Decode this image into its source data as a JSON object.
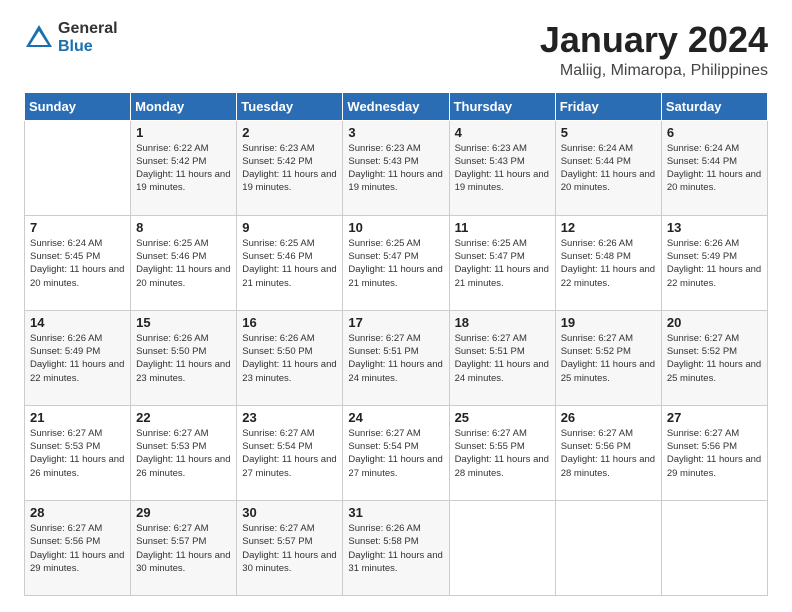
{
  "logo": {
    "general": "General",
    "blue": "Blue"
  },
  "header": {
    "title": "January 2024",
    "subtitle": "Maliig, Mimaropa, Philippines"
  },
  "weekdays": [
    "Sunday",
    "Monday",
    "Tuesday",
    "Wednesday",
    "Thursday",
    "Friday",
    "Saturday"
  ],
  "weeks": [
    [
      {
        "day": "",
        "sunrise": "",
        "sunset": "",
        "daylight": ""
      },
      {
        "day": "1",
        "sunrise": "Sunrise: 6:22 AM",
        "sunset": "Sunset: 5:42 PM",
        "daylight": "Daylight: 11 hours and 19 minutes."
      },
      {
        "day": "2",
        "sunrise": "Sunrise: 6:23 AM",
        "sunset": "Sunset: 5:42 PM",
        "daylight": "Daylight: 11 hours and 19 minutes."
      },
      {
        "day": "3",
        "sunrise": "Sunrise: 6:23 AM",
        "sunset": "Sunset: 5:43 PM",
        "daylight": "Daylight: 11 hours and 19 minutes."
      },
      {
        "day": "4",
        "sunrise": "Sunrise: 6:23 AM",
        "sunset": "Sunset: 5:43 PM",
        "daylight": "Daylight: 11 hours and 19 minutes."
      },
      {
        "day": "5",
        "sunrise": "Sunrise: 6:24 AM",
        "sunset": "Sunset: 5:44 PM",
        "daylight": "Daylight: 11 hours and 20 minutes."
      },
      {
        "day": "6",
        "sunrise": "Sunrise: 6:24 AM",
        "sunset": "Sunset: 5:44 PM",
        "daylight": "Daylight: 11 hours and 20 minutes."
      }
    ],
    [
      {
        "day": "7",
        "sunrise": "Sunrise: 6:24 AM",
        "sunset": "Sunset: 5:45 PM",
        "daylight": "Daylight: 11 hours and 20 minutes."
      },
      {
        "day": "8",
        "sunrise": "Sunrise: 6:25 AM",
        "sunset": "Sunset: 5:46 PM",
        "daylight": "Daylight: 11 hours and 20 minutes."
      },
      {
        "day": "9",
        "sunrise": "Sunrise: 6:25 AM",
        "sunset": "Sunset: 5:46 PM",
        "daylight": "Daylight: 11 hours and 21 minutes."
      },
      {
        "day": "10",
        "sunrise": "Sunrise: 6:25 AM",
        "sunset": "Sunset: 5:47 PM",
        "daylight": "Daylight: 11 hours and 21 minutes."
      },
      {
        "day": "11",
        "sunrise": "Sunrise: 6:25 AM",
        "sunset": "Sunset: 5:47 PM",
        "daylight": "Daylight: 11 hours and 21 minutes."
      },
      {
        "day": "12",
        "sunrise": "Sunrise: 6:26 AM",
        "sunset": "Sunset: 5:48 PM",
        "daylight": "Daylight: 11 hours and 22 minutes."
      },
      {
        "day": "13",
        "sunrise": "Sunrise: 6:26 AM",
        "sunset": "Sunset: 5:49 PM",
        "daylight": "Daylight: 11 hours and 22 minutes."
      }
    ],
    [
      {
        "day": "14",
        "sunrise": "Sunrise: 6:26 AM",
        "sunset": "Sunset: 5:49 PM",
        "daylight": "Daylight: 11 hours and 22 minutes."
      },
      {
        "day": "15",
        "sunrise": "Sunrise: 6:26 AM",
        "sunset": "Sunset: 5:50 PM",
        "daylight": "Daylight: 11 hours and 23 minutes."
      },
      {
        "day": "16",
        "sunrise": "Sunrise: 6:26 AM",
        "sunset": "Sunset: 5:50 PM",
        "daylight": "Daylight: 11 hours and 23 minutes."
      },
      {
        "day": "17",
        "sunrise": "Sunrise: 6:27 AM",
        "sunset": "Sunset: 5:51 PM",
        "daylight": "Daylight: 11 hours and 24 minutes."
      },
      {
        "day": "18",
        "sunrise": "Sunrise: 6:27 AM",
        "sunset": "Sunset: 5:51 PM",
        "daylight": "Daylight: 11 hours and 24 minutes."
      },
      {
        "day": "19",
        "sunrise": "Sunrise: 6:27 AM",
        "sunset": "Sunset: 5:52 PM",
        "daylight": "Daylight: 11 hours and 25 minutes."
      },
      {
        "day": "20",
        "sunrise": "Sunrise: 6:27 AM",
        "sunset": "Sunset: 5:52 PM",
        "daylight": "Daylight: 11 hours and 25 minutes."
      }
    ],
    [
      {
        "day": "21",
        "sunrise": "Sunrise: 6:27 AM",
        "sunset": "Sunset: 5:53 PM",
        "daylight": "Daylight: 11 hours and 26 minutes."
      },
      {
        "day": "22",
        "sunrise": "Sunrise: 6:27 AM",
        "sunset": "Sunset: 5:53 PM",
        "daylight": "Daylight: 11 hours and 26 minutes."
      },
      {
        "day": "23",
        "sunrise": "Sunrise: 6:27 AM",
        "sunset": "Sunset: 5:54 PM",
        "daylight": "Daylight: 11 hours and 27 minutes."
      },
      {
        "day": "24",
        "sunrise": "Sunrise: 6:27 AM",
        "sunset": "Sunset: 5:54 PM",
        "daylight": "Daylight: 11 hours and 27 minutes."
      },
      {
        "day": "25",
        "sunrise": "Sunrise: 6:27 AM",
        "sunset": "Sunset: 5:55 PM",
        "daylight": "Daylight: 11 hours and 28 minutes."
      },
      {
        "day": "26",
        "sunrise": "Sunrise: 6:27 AM",
        "sunset": "Sunset: 5:56 PM",
        "daylight": "Daylight: 11 hours and 28 minutes."
      },
      {
        "day": "27",
        "sunrise": "Sunrise: 6:27 AM",
        "sunset": "Sunset: 5:56 PM",
        "daylight": "Daylight: 11 hours and 29 minutes."
      }
    ],
    [
      {
        "day": "28",
        "sunrise": "Sunrise: 6:27 AM",
        "sunset": "Sunset: 5:56 PM",
        "daylight": "Daylight: 11 hours and 29 minutes."
      },
      {
        "day": "29",
        "sunrise": "Sunrise: 6:27 AM",
        "sunset": "Sunset: 5:57 PM",
        "daylight": "Daylight: 11 hours and 30 minutes."
      },
      {
        "day": "30",
        "sunrise": "Sunrise: 6:27 AM",
        "sunset": "Sunset: 5:57 PM",
        "daylight": "Daylight: 11 hours and 30 minutes."
      },
      {
        "day": "31",
        "sunrise": "Sunrise: 6:26 AM",
        "sunset": "Sunset: 5:58 PM",
        "daylight": "Daylight: 11 hours and 31 minutes."
      },
      {
        "day": "",
        "sunrise": "",
        "sunset": "",
        "daylight": ""
      },
      {
        "day": "",
        "sunrise": "",
        "sunset": "",
        "daylight": ""
      },
      {
        "day": "",
        "sunrise": "",
        "sunset": "",
        "daylight": ""
      }
    ]
  ]
}
